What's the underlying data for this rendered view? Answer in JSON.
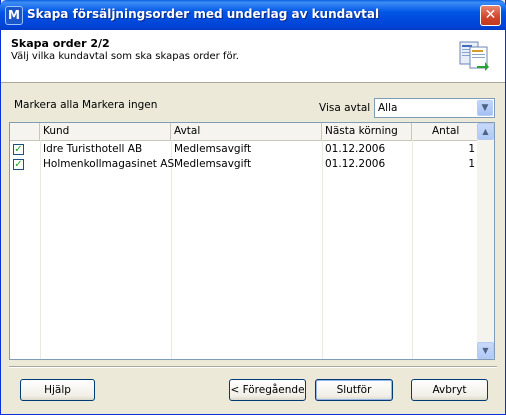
{
  "window": {
    "title": "Skapa försäljningsorder med underlag av kundavtal",
    "app_icon_letter": "M",
    "close_glyph": "✕"
  },
  "header": {
    "title": "Skapa order 2/2",
    "subtitle": "Välj vilka kundavtal som ska skapas order för."
  },
  "toolbar": {
    "select_all": "Markera alla",
    "select_none": "Markera ingen",
    "filter_label": "Visa avtal",
    "filter_value": "Alla"
  },
  "grid": {
    "columns": [
      "Kund",
      "Avtal",
      "Nästa körning",
      "Antal"
    ],
    "rows": [
      {
        "checked": true,
        "kund": "Idre Turisthotell AB",
        "avtal": "Medlemsavgift",
        "nasta": "01.12.2006",
        "antal": "1"
      },
      {
        "checked": true,
        "kund": "Holmenkollmagasinet AS",
        "avtal": "Medlemsavgift",
        "nasta": "01.12.2006",
        "antal": "1"
      }
    ]
  },
  "buttons": {
    "help": "Hjälp",
    "previous": "< Föregående",
    "finish": "Slutför",
    "cancel": "Avbryt"
  },
  "colors": {
    "titlebar": "#0055e5",
    "check": "#21a121",
    "window_bg": "#ece9d8"
  }
}
